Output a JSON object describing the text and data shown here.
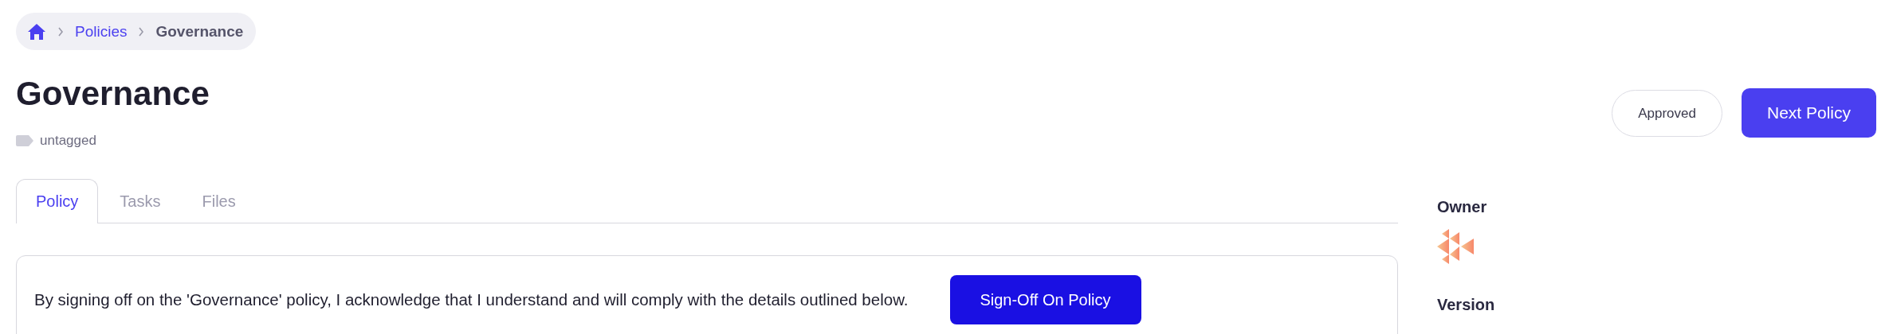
{
  "breadcrumb": {
    "items": [
      {
        "label": "Policies",
        "kind": "link"
      },
      {
        "label": "Governance",
        "kind": "current"
      }
    ]
  },
  "title": "Governance",
  "tags": [
    "untagged"
  ],
  "status": "Approved",
  "actions": [
    "Next Policy"
  ],
  "tabs": [
    {
      "label": "Policy",
      "selected": true
    },
    {
      "label": "Tasks",
      "selected": false
    },
    {
      "label": "Files",
      "selected": false
    }
  ],
  "notice": {
    "text": "By signing off on the 'Governance' policy, I acknowledge that I understand and will comply with the details outlined below.",
    "button": "Sign-Off On Policy"
  },
  "sidebar": {
    "owner_label": "Owner",
    "version_label": "Version"
  }
}
